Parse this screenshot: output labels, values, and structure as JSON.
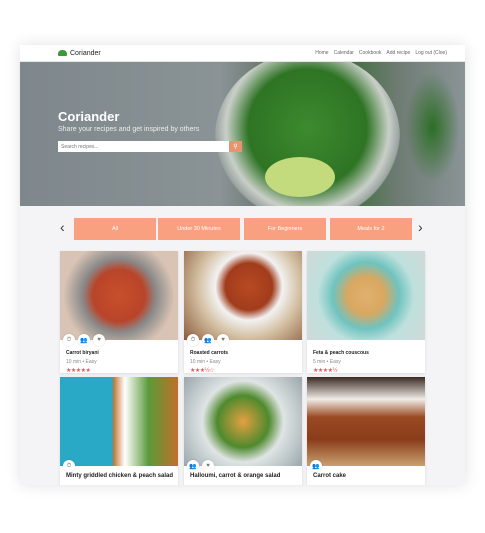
{
  "nav": {
    "brand": "Coriander",
    "links": [
      "Home",
      "Calendar",
      "Cookbook",
      "Add recipe",
      "Log out (Cloe)"
    ]
  },
  "hero": {
    "title": "Coriander",
    "subtitle": "Share your recipes and get inspired by others",
    "search_placeholder": "Search recipes..."
  },
  "filters": [
    "All",
    "Under 30 Minutes",
    "For Beginners",
    "Meals for 2"
  ],
  "colors": {
    "accent": "#f9a081",
    "star": "#e8505b",
    "brand": "#3a9a35"
  },
  "recipes": [
    {
      "title": "Carrot biryani",
      "meta": "10 min • Easy",
      "rating": 5,
      "stars": "★★★★★",
      "icons": [
        "timer",
        "people",
        "heart"
      ]
    },
    {
      "title": "Roasted carrots",
      "meta": "10 min • Easy",
      "rating": 3.5,
      "stars": "★★★½☆",
      "icons": [
        "timer",
        "people",
        "heart"
      ]
    },
    {
      "title": "Feta & peach couscous",
      "meta": "5 min • Easy",
      "rating": 4.5,
      "stars": "★★★★½",
      "icons": []
    },
    {
      "title": "Minty griddled chicken & peach salad",
      "icons": [
        "timer"
      ]
    },
    {
      "title": "Halloumi, carrot & orange salad",
      "icons": [
        "people",
        "heart"
      ]
    },
    {
      "title": "Carrot cake",
      "icons": [
        "people"
      ]
    }
  ]
}
